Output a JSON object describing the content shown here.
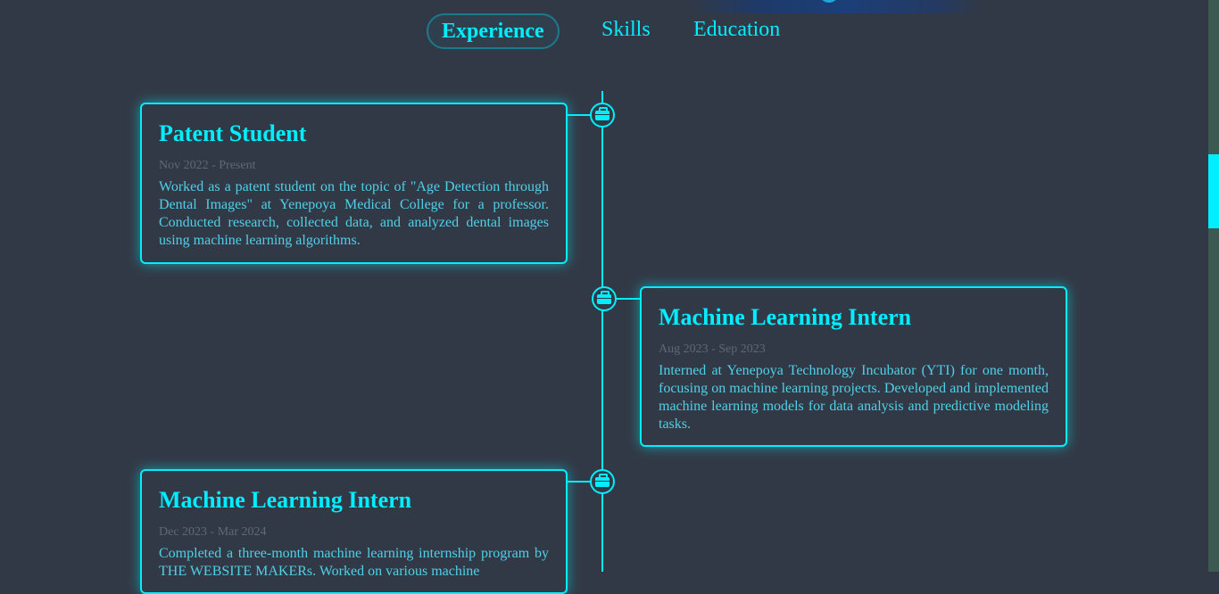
{
  "nav": {
    "tabs": [
      {
        "label": "Experience",
        "active": true
      },
      {
        "label": "Skills",
        "active": false
      },
      {
        "label": "Education",
        "active": false
      }
    ]
  },
  "timeline": {
    "items": [
      {
        "side": "left",
        "icon": "briefcase-icon",
        "title": "Patent Student",
        "date": "Nov 2022 - Present",
        "description": "Worked as a patent student on the topic of \"Age Detection through Dental Images\" at Yenepoya Medical College for a professor. Conducted research, collected data, and analyzed dental images using machine learning algorithms."
      },
      {
        "side": "right",
        "icon": "briefcase-icon",
        "title": "Machine Learning Intern",
        "date": "Aug 2023 - Sep 2023",
        "description": "Interned at Yenepoya Technology Incubator (YTI) for one month, focusing on machine learning projects. Developed and implemented machine learning models for data analysis and predictive modeling tasks."
      },
      {
        "side": "left",
        "icon": "briefcase-icon",
        "title": "Machine Learning Intern",
        "date": "Dec 2023 - Mar 2024",
        "description": "Completed a three-month machine learning internship program by THE WEBSITE MAKERs. Worked on various machine"
      }
    ]
  },
  "colors": {
    "background": "#323946",
    "accent": "#00eeff",
    "date_text": "#5e6877",
    "scrollbar_track": "#3c5a52"
  }
}
